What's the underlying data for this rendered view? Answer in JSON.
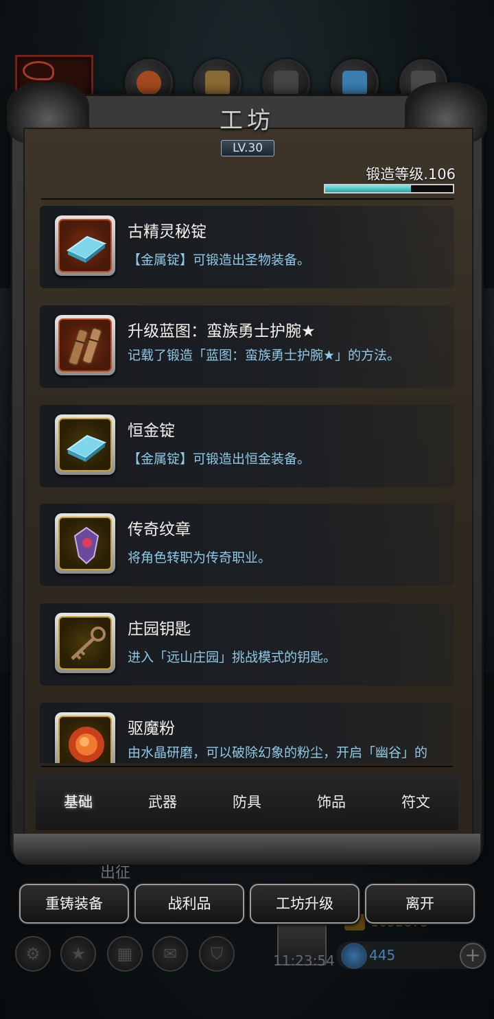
{
  "workshop": {
    "title": "工坊",
    "level": "LV.30",
    "forge_level_label": "锻造等级.106",
    "forge_progress": 0.67
  },
  "items": [
    {
      "name": "古精灵秘锭",
      "desc": "【金属锭】可锻造出圣物装备。",
      "icon": "blue-ingot-icon",
      "frame": "red"
    },
    {
      "name": "升级蓝图：蛮族勇士护腕★",
      "desc": "记载了锻造「蓝图：蛮族勇士护腕★」的方法。",
      "icon": "blueprint-scroll-icon",
      "frame": "red"
    },
    {
      "name": "恒金锭",
      "desc": "【金属锭】可锻造出恒金装备。",
      "icon": "blue-ingot-icon",
      "frame": "gold"
    },
    {
      "name": "传奇纹章",
      "desc": "将角色转职为传奇职业。",
      "icon": "crest-icon",
      "frame": "gold"
    },
    {
      "name": "庄园钥匙",
      "desc": "进入「远山庄园」挑战模式的钥匙。",
      "icon": "key-icon",
      "frame": "gold"
    },
    {
      "name": "驱魔粉",
      "desc": "由水晶研磨，可以破除幻象的粉尘，开启「幽谷」的道具。",
      "icon": "red-powder-icon",
      "frame": "gold"
    }
  ],
  "tabs": [
    "基础",
    "武器",
    "防具",
    "饰品",
    "符文"
  ],
  "active_tab": "基础",
  "behind_label": "出征",
  "buttons": [
    "重铸装备",
    "战利品",
    "工坊升级",
    "离开"
  ],
  "hud": {
    "time": "11:23:54",
    "gold": "1052875",
    "gems": "445"
  }
}
